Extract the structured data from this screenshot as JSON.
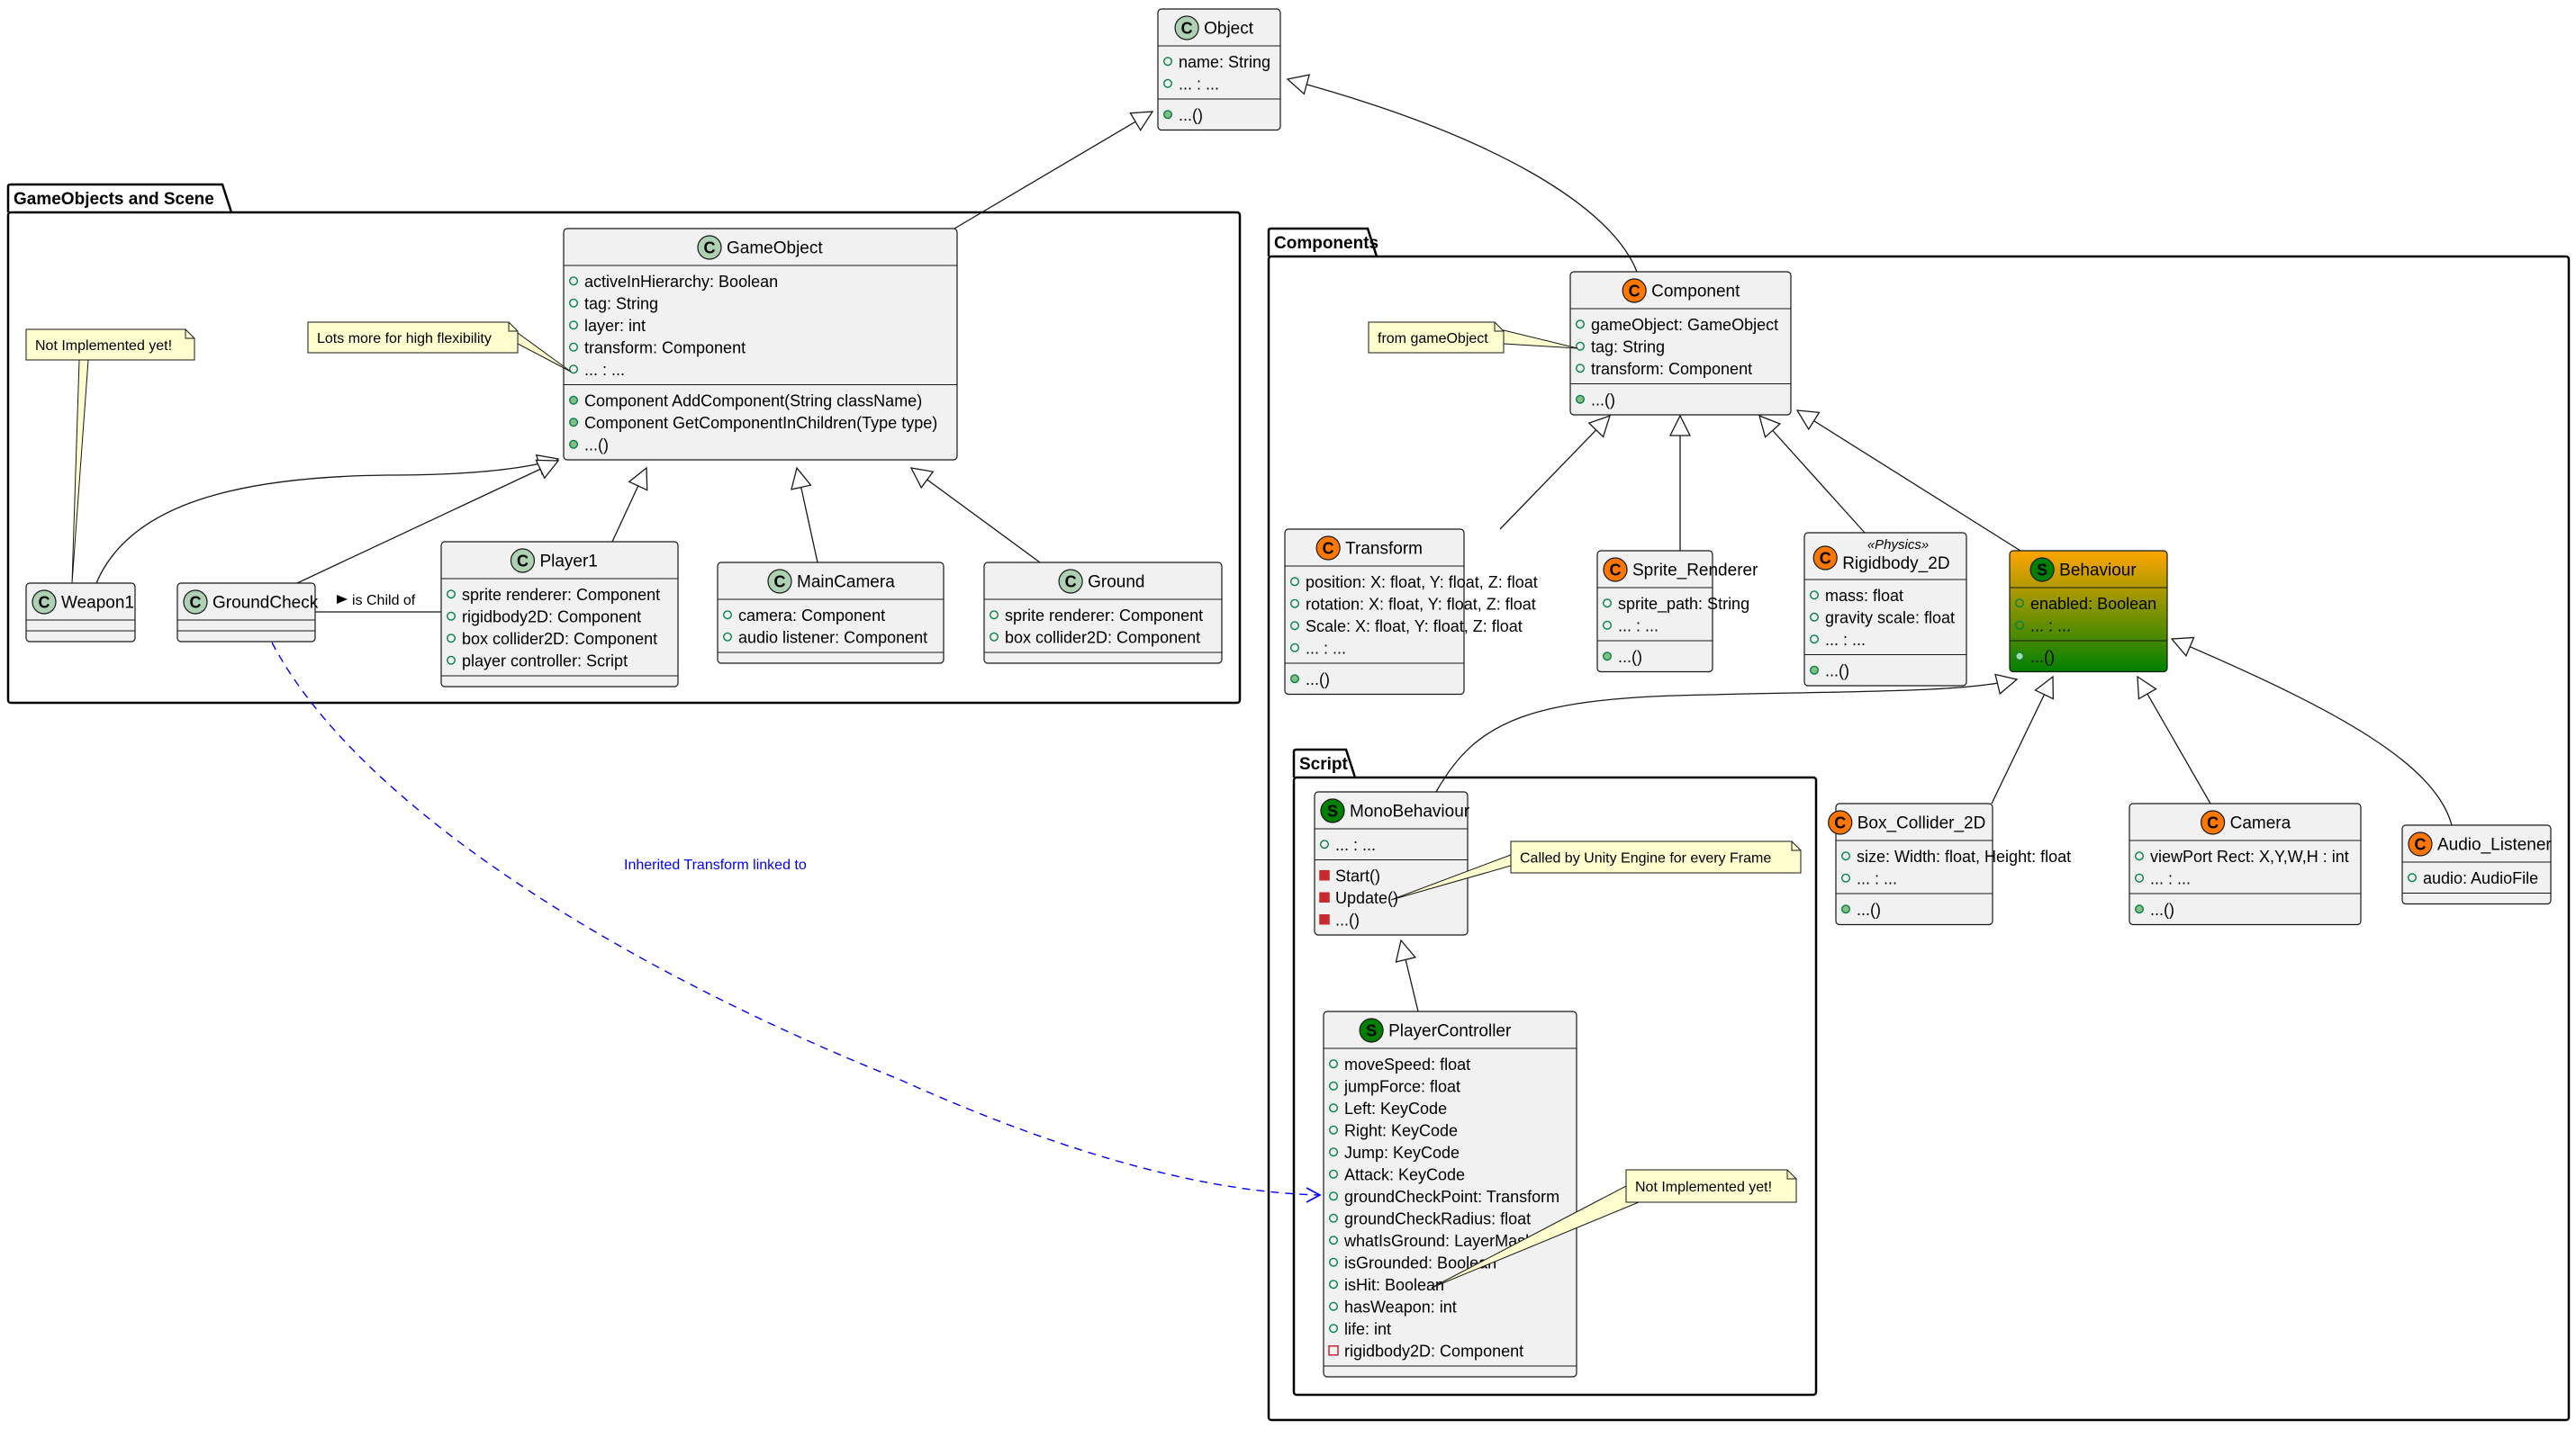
{
  "colors": {
    "class_fill": "#f1f1f1",
    "class_spot": "#add1b2",
    "component_spot": "#ff7700",
    "script_spot": "#008000",
    "behaviour_gradient_top": "#ffa500",
    "behaviour_gradient_bottom": "#008000",
    "note_fill": "#fefece",
    "public_field": "#038048",
    "private_member": "#c82930",
    "dependency": "#0000ff"
  },
  "packages": [
    {
      "id": "gameobjects",
      "title": "GameObjects and Scene"
    },
    {
      "id": "components",
      "title": "Components"
    },
    {
      "id": "script",
      "title": "Script"
    }
  ],
  "classes": [
    {
      "id": "object",
      "name": "Object",
      "spot": "C",
      "spot_kind": "class",
      "fields": [
        {
          "vis": "public",
          "text": "name: String"
        },
        {
          "vis": "public",
          "text": "... : ..."
        }
      ],
      "methods": [
        {
          "vis": "public",
          "text": "...()"
        }
      ]
    },
    {
      "id": "gameobject",
      "name": "GameObject",
      "spot": "C",
      "spot_kind": "class",
      "fields": [
        {
          "vis": "public",
          "text": "activeInHierarchy: Boolean"
        },
        {
          "vis": "public",
          "text": "tag: String"
        },
        {
          "vis": "public",
          "text": "layer: int"
        },
        {
          "vis": "public",
          "text": "transform: Component"
        },
        {
          "vis": "public",
          "text": "... : ..."
        }
      ],
      "methods": [
        {
          "vis": "public",
          "text": "Component AddComponent(String className)"
        },
        {
          "vis": "public",
          "text": "Component GetComponentInChildren(Type type)"
        },
        {
          "vis": "public",
          "text": "...()"
        }
      ]
    },
    {
      "id": "weapon1",
      "name": "Weapon1",
      "spot": "C",
      "spot_kind": "class",
      "fields": [],
      "methods": []
    },
    {
      "id": "groundcheck",
      "name": "GroundCheck",
      "spot": "C",
      "spot_kind": "class",
      "fields": [],
      "methods": []
    },
    {
      "id": "player1",
      "name": "Player1",
      "spot": "C",
      "spot_kind": "class",
      "fields": [
        {
          "vis": "public",
          "text": "sprite renderer: Component"
        },
        {
          "vis": "public",
          "text": "rigidbody2D: Component"
        },
        {
          "vis": "public",
          "text": "box collider2D: Component"
        },
        {
          "vis": "public",
          "text": "player controller: Script"
        }
      ],
      "methods": []
    },
    {
      "id": "maincamera",
      "name": "MainCamera",
      "spot": "C",
      "spot_kind": "class",
      "fields": [
        {
          "vis": "public",
          "text": "camera: Component"
        },
        {
          "vis": "public",
          "text": "audio listener: Component"
        }
      ],
      "methods": []
    },
    {
      "id": "ground",
      "name": "Ground",
      "spot": "C",
      "spot_kind": "class",
      "fields": [
        {
          "vis": "public",
          "text": "sprite renderer: Component"
        },
        {
          "vis": "public",
          "text": "box collider2D: Component"
        }
      ],
      "methods": []
    },
    {
      "id": "component",
      "name": "Component",
      "spot": "C",
      "spot_kind": "component",
      "fields": [
        {
          "vis": "public",
          "text": "gameObject: GameObject"
        },
        {
          "vis": "public",
          "text": "tag: String"
        },
        {
          "vis": "public",
          "text": "transform: Component"
        }
      ],
      "methods": [
        {
          "vis": "public",
          "text": "...()"
        }
      ]
    },
    {
      "id": "transform",
      "name": "Transform",
      "spot": "C",
      "spot_kind": "component",
      "fields": [
        {
          "vis": "public",
          "text": "position: X: float, Y: float, Z: float"
        },
        {
          "vis": "public",
          "text": "rotation: X: float, Y: float, Z: float"
        },
        {
          "vis": "public",
          "text": "Scale: X: float, Y: float, Z: float"
        },
        {
          "vis": "public",
          "text": "... : ..."
        }
      ],
      "methods": [
        {
          "vis": "public",
          "text": "...()"
        }
      ]
    },
    {
      "id": "sprite_renderer",
      "name": "Sprite_Renderer",
      "spot": "C",
      "spot_kind": "component",
      "fields": [
        {
          "vis": "public",
          "text": "sprite_path: String"
        },
        {
          "vis": "public",
          "text": "... : ..."
        }
      ],
      "methods": [
        {
          "vis": "public",
          "text": "...()"
        }
      ]
    },
    {
      "id": "rigidbody_2d",
      "name": "Rigidbody_2D",
      "stereotype": "«Physics»",
      "spot": "C",
      "spot_kind": "component",
      "fields": [
        {
          "vis": "public",
          "text": "mass: float"
        },
        {
          "vis": "public",
          "text": "gravity scale: float"
        },
        {
          "vis": "public",
          "text": "... : ..."
        }
      ],
      "methods": [
        {
          "vis": "public",
          "text": "...()"
        }
      ]
    },
    {
      "id": "behaviour",
      "name": "Behaviour",
      "spot": "S",
      "spot_kind": "script",
      "gradient": true,
      "fields": [
        {
          "vis": "public",
          "text": "enabled: Boolean"
        },
        {
          "vis": "public",
          "text": "... : ..."
        }
      ],
      "methods": [
        {
          "vis": "public",
          "text": "...()"
        }
      ]
    },
    {
      "id": "box_collider_2d",
      "name": "Box_Collider_2D",
      "spot": "C",
      "spot_kind": "component",
      "fields": [
        {
          "vis": "public",
          "text": "size: Width: float, Height: float"
        },
        {
          "vis": "public",
          "text": "... : ..."
        }
      ],
      "methods": [
        {
          "vis": "public",
          "text": "...()"
        }
      ]
    },
    {
      "id": "camera",
      "name": "Camera",
      "spot": "C",
      "spot_kind": "component",
      "fields": [
        {
          "vis": "public",
          "text": "viewPort Rect: X,Y,W,H : int"
        },
        {
          "vis": "public",
          "text": "... : ..."
        }
      ],
      "methods": [
        {
          "vis": "public",
          "text": "...()"
        }
      ]
    },
    {
      "id": "audio_listener",
      "name": "Audio_Listener",
      "spot": "C",
      "spot_kind": "component",
      "fields": [
        {
          "vis": "public",
          "text": "audio: AudioFile"
        }
      ],
      "methods": []
    },
    {
      "id": "monobehaviour",
      "name": "MonoBehaviour",
      "spot": "S",
      "spot_kind": "script",
      "fields": [
        {
          "vis": "public",
          "text": "... : ..."
        }
      ],
      "methods": [
        {
          "vis": "private",
          "text": "Start()"
        },
        {
          "vis": "private",
          "text": "Update()"
        },
        {
          "vis": "private",
          "text": "...()"
        }
      ]
    },
    {
      "id": "playercontroller",
      "name": "PlayerController",
      "spot": "S",
      "spot_kind": "script",
      "fields": [
        {
          "vis": "public",
          "text": "moveSpeed: float"
        },
        {
          "vis": "public",
          "text": "jumpForce: float"
        },
        {
          "vis": "public",
          "text": "Left: KeyCode"
        },
        {
          "vis": "public",
          "text": "Right: KeyCode"
        },
        {
          "vis": "public",
          "text": "Jump: KeyCode"
        },
        {
          "vis": "public",
          "text": "Attack: KeyCode"
        },
        {
          "vis": "public",
          "text": "groundCheckPoint: Transform"
        },
        {
          "vis": "public",
          "text": "groundCheckRadius: float"
        },
        {
          "vis": "public",
          "text": "whatIsGround: LayerMask"
        },
        {
          "vis": "public",
          "text": "isGrounded: Boolean"
        },
        {
          "vis": "public",
          "text": "isHit: Boolean"
        },
        {
          "vis": "public",
          "text": "hasWeapon: int"
        },
        {
          "vis": "public",
          "text": "life: int"
        },
        {
          "vis": "private",
          "text": "rigidbody2D: Component"
        }
      ],
      "methods": []
    }
  ],
  "notes": [
    {
      "id": "note-weapon",
      "text": "Not Implemented yet!",
      "attached_to": "weapon1"
    },
    {
      "id": "note-flex",
      "text": "Lots more for high flexibility",
      "attached_to": "gameobject"
    },
    {
      "id": "note-fromgo",
      "text": "from gameObject",
      "attached_to": "component"
    },
    {
      "id": "note-update",
      "text": "Called by Unity Engine for every Frame",
      "attached_to": "monobehaviour"
    },
    {
      "id": "note-ishit",
      "text": "Not Implemented yet!",
      "attached_to": "playercontroller"
    }
  ],
  "relations": [
    {
      "type": "inheritance",
      "from": "gameobject",
      "to": "object"
    },
    {
      "type": "inheritance",
      "from": "component",
      "to": "object"
    },
    {
      "type": "inheritance",
      "from": "weapon1",
      "to": "gameobject"
    },
    {
      "type": "inheritance",
      "from": "groundcheck",
      "to": "gameobject"
    },
    {
      "type": "inheritance",
      "from": "player1",
      "to": "gameobject"
    },
    {
      "type": "inheritance",
      "from": "maincamera",
      "to": "gameobject"
    },
    {
      "type": "inheritance",
      "from": "ground",
      "to": "gameobject"
    },
    {
      "type": "inheritance",
      "from": "transform",
      "to": "component"
    },
    {
      "type": "inheritance",
      "from": "sprite_renderer",
      "to": "component"
    },
    {
      "type": "inheritance",
      "from": "rigidbody_2d",
      "to": "component"
    },
    {
      "type": "inheritance",
      "from": "behaviour",
      "to": "component"
    },
    {
      "type": "inheritance",
      "from": "monobehaviour",
      "to": "behaviour"
    },
    {
      "type": "inheritance",
      "from": "box_collider_2d",
      "to": "behaviour"
    },
    {
      "type": "inheritance",
      "from": "camera",
      "to": "behaviour"
    },
    {
      "type": "inheritance",
      "from": "audio_listener",
      "to": "behaviour"
    },
    {
      "type": "inheritance",
      "from": "playercontroller",
      "to": "monobehaviour"
    },
    {
      "type": "association",
      "from": "groundcheck",
      "to": "player1",
      "label": "is Child of"
    },
    {
      "type": "dependency",
      "from": "groundcheck",
      "to": "playercontroller",
      "label": "Inherited Transform linked to"
    }
  ]
}
